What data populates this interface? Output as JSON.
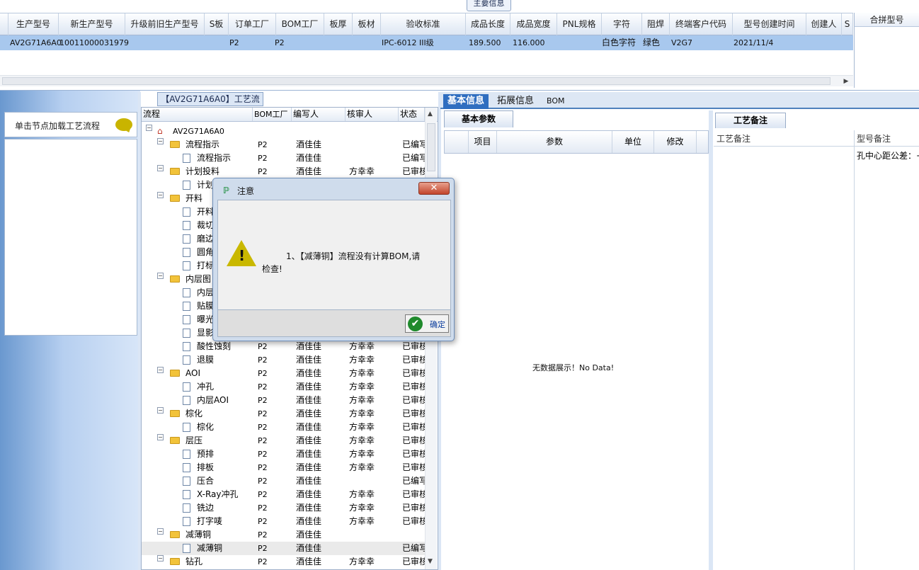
{
  "top": {
    "group_tab": "主要信息",
    "columns": [
      "生产型号",
      "新生产型号",
      "升级前旧生产型号",
      "S板",
      "订单工厂",
      "BOM工厂",
      "板厚",
      "板材",
      "验收标准",
      "成品长度",
      "成品宽度",
      "PNL规格",
      "字符",
      "阻焊",
      "终端客户代码",
      "型号创建时间",
      "创建人",
      "S"
    ],
    "row": {
      "model": "AV2G71A6A0",
      "new_model": "10011000031979",
      "order_factory": "P2",
      "bom_factory": "P2",
      "standard": "IPC-6012 III级",
      "length": "189.500",
      "width": "116.000",
      "char": "白色字符",
      "mask": "绿色",
      "customer": "V2G7",
      "created": "2021/11/4"
    },
    "merge_header": "合拼型号"
  },
  "left": {
    "load_button": "单击节点加载工艺流程"
  },
  "tree": {
    "tab": "【AV2G71A6A0】工艺流程",
    "headers": [
      "流程",
      "BOM工厂",
      "编写人",
      "核审人",
      "状态"
    ],
    "root": "AV2G71A6A0",
    "rows": [
      {
        "name": "流程指示",
        "bom": "P2",
        "writer": "酒佳佳",
        "reviewer": "",
        "status": "已编写",
        "level": 1
      },
      {
        "name": "流程指示",
        "bom": "P2",
        "writer": "酒佳佳",
        "reviewer": "",
        "status": "已编写",
        "level": 2
      },
      {
        "name": "计划投料",
        "bom": "P2",
        "writer": "酒佳佳",
        "reviewer": "方幸幸",
        "status": "已审核",
        "level": 1
      },
      {
        "name": "计划",
        "bom": "",
        "writer": "",
        "reviewer": "",
        "status": "",
        "level": 2
      },
      {
        "name": "开料",
        "bom": "",
        "writer": "",
        "reviewer": "",
        "status": "",
        "level": 1
      },
      {
        "name": "开料",
        "bom": "",
        "writer": "",
        "reviewer": "",
        "status": "",
        "level": 2
      },
      {
        "name": "裁切",
        "bom": "",
        "writer": "",
        "reviewer": "",
        "status": "",
        "level": 2
      },
      {
        "name": "磨边",
        "bom": "",
        "writer": "",
        "reviewer": "",
        "status": "",
        "level": 2
      },
      {
        "name": "圆角",
        "bom": "",
        "writer": "",
        "reviewer": "",
        "status": "",
        "level": 2
      },
      {
        "name": "打标",
        "bom": "",
        "writer": "",
        "reviewer": "",
        "status": "",
        "level": 2
      },
      {
        "name": "内层图",
        "bom": "",
        "writer": "",
        "reviewer": "",
        "status": "",
        "level": 1
      },
      {
        "name": "内层",
        "bom": "",
        "writer": "",
        "reviewer": "",
        "status": "",
        "level": 2
      },
      {
        "name": "贴膜",
        "bom": "",
        "writer": "",
        "reviewer": "",
        "status": "",
        "level": 2
      },
      {
        "name": "曝光",
        "bom": "",
        "writer": "",
        "reviewer": "",
        "status": "",
        "level": 2
      },
      {
        "name": "显影",
        "bom": "",
        "writer": "",
        "reviewer": "",
        "status": "",
        "level": 2
      },
      {
        "name": "酸性蚀刻",
        "bom": "P2",
        "writer": "酒佳佳",
        "reviewer": "方幸幸",
        "status": "已审核",
        "level": 2
      },
      {
        "name": "退膜",
        "bom": "P2",
        "writer": "酒佳佳",
        "reviewer": "方幸幸",
        "status": "已审核",
        "level": 2
      },
      {
        "name": "AOI",
        "bom": "P2",
        "writer": "酒佳佳",
        "reviewer": "方幸幸",
        "status": "已审核",
        "level": 1
      },
      {
        "name": "冲孔",
        "bom": "P2",
        "writer": "酒佳佳",
        "reviewer": "方幸幸",
        "status": "已审核",
        "level": 2
      },
      {
        "name": "内层AOI",
        "bom": "P2",
        "writer": "酒佳佳",
        "reviewer": "方幸幸",
        "status": "已审核",
        "level": 2
      },
      {
        "name": "棕化",
        "bom": "P2",
        "writer": "酒佳佳",
        "reviewer": "方幸幸",
        "status": "已审核",
        "level": 1
      },
      {
        "name": "棕化",
        "bom": "P2",
        "writer": "酒佳佳",
        "reviewer": "方幸幸",
        "status": "已审核",
        "level": 2
      },
      {
        "name": "层压",
        "bom": "P2",
        "writer": "酒佳佳",
        "reviewer": "方幸幸",
        "status": "已审核",
        "level": 1
      },
      {
        "name": "预排",
        "bom": "P2",
        "writer": "酒佳佳",
        "reviewer": "方幸幸",
        "status": "已审核",
        "level": 2
      },
      {
        "name": "排板",
        "bom": "P2",
        "writer": "酒佳佳",
        "reviewer": "方幸幸",
        "status": "已审核",
        "level": 2
      },
      {
        "name": "压合",
        "bom": "P2",
        "writer": "酒佳佳",
        "reviewer": "",
        "status": "已编写",
        "level": 2
      },
      {
        "name": "X-Ray冲孔",
        "bom": "P2",
        "writer": "酒佳佳",
        "reviewer": "方幸幸",
        "status": "已审核",
        "level": 2
      },
      {
        "name": "铣边",
        "bom": "P2",
        "writer": "酒佳佳",
        "reviewer": "方幸幸",
        "status": "已审核",
        "level": 2
      },
      {
        "name": "打字唛",
        "bom": "P2",
        "writer": "酒佳佳",
        "reviewer": "方幸幸",
        "status": "已审核",
        "level": 2
      },
      {
        "name": "减薄铜",
        "bom": "P2",
        "writer": "酒佳佳",
        "reviewer": "",
        "status": "",
        "level": 1
      },
      {
        "name": "减薄铜",
        "bom": "P2",
        "writer": "酒佳佳",
        "reviewer": "",
        "status": "已编写",
        "level": 2
      },
      {
        "name": "钻孔",
        "bom": "P2",
        "writer": "酒佳佳",
        "reviewer": "方幸幸",
        "status": "已审核",
        "level": 1
      }
    ]
  },
  "right": {
    "tabs": [
      "基本信息",
      "拓展信息",
      "BOM"
    ],
    "basic_tab": "基本参数",
    "basic_headers": [
      "项目",
      "参数",
      "单位",
      "修改"
    ],
    "no_data": "无数据展示！No Data!",
    "note_tab": "工艺备注",
    "note_headers": [
      "工艺备注",
      "型号备注"
    ],
    "note_text": "孔中心距公差：+"
  },
  "dialog": {
    "title": "注意",
    "close": "✕",
    "message_line1": "1、【减薄铜】流程没有计算BOM,请",
    "message_line2": "检查!",
    "ok": "确定"
  }
}
